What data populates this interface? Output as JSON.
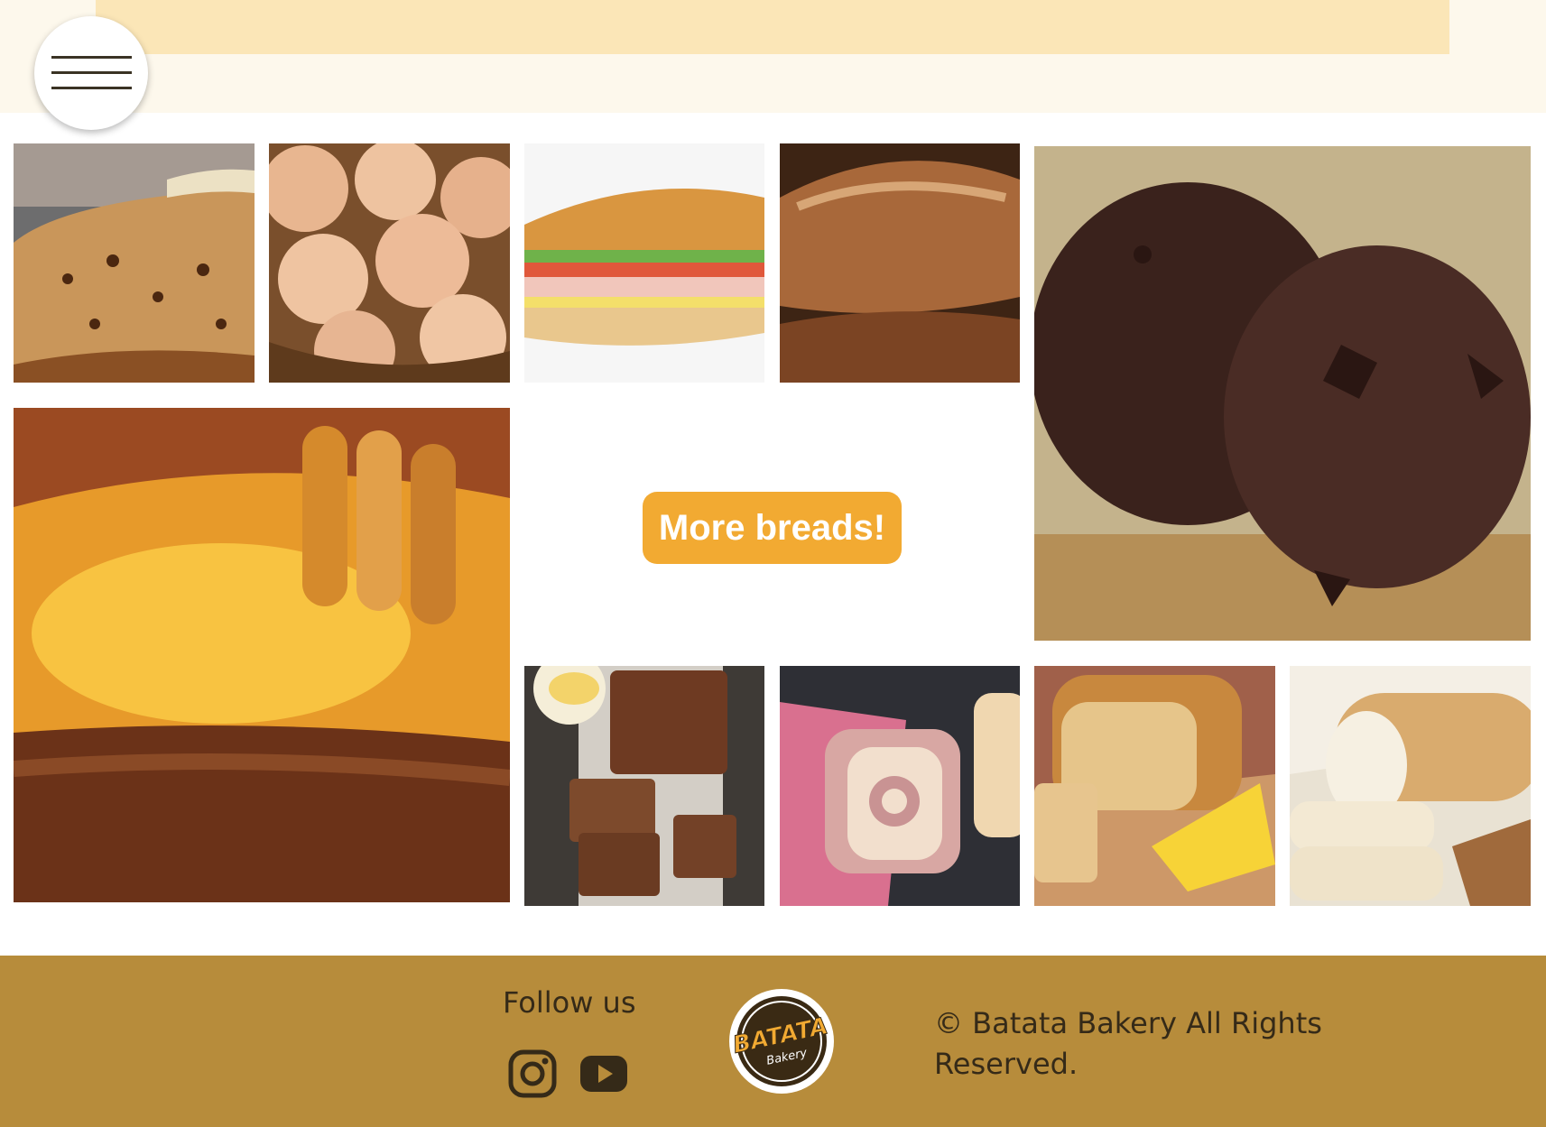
{
  "header": {
    "menu_icon": "hamburger-menu-icon",
    "colors": {
      "band": "#fbe6b7",
      "background": "#fdf8ec"
    }
  },
  "gallery": {
    "tiles": [
      {
        "name": "fruit-cake-slices-image",
        "icon": "fruit-cake-slices"
      },
      {
        "name": "cheese-bread-rolls-image",
        "icon": "cheese-bread-rolls"
      },
      {
        "name": "ham-sandwich-image",
        "icon": "submarine-sandwich"
      },
      {
        "name": "baguette-loaves-image",
        "icon": "baguette"
      },
      {
        "name": "chocolate-cookies-image",
        "icon": "chocolate-chip-cookies"
      },
      {
        "name": "honey-bread-image",
        "icon": "honey-dipper-on-bread"
      },
      {
        "name": "banana-bread-image",
        "icon": "banana-bread-slices"
      },
      {
        "name": "ham-swirl-bread-image",
        "icon": "ham-swirl-bread"
      },
      {
        "name": "pineapple-loaf-image",
        "icon": "pineapple-cake-loaf"
      },
      {
        "name": "white-bread-loaf-image",
        "icon": "white-bread-loaf"
      }
    ],
    "cta_label": "More breads!",
    "cta_color": "#f2aa32"
  },
  "footer": {
    "follow_label": "Follow us",
    "social_icons": [
      "instagram-icon",
      "youtube-icon"
    ],
    "logo_text": "BATATA",
    "logo_subtext": "Bakery",
    "copyright": "© Batata Bakery All Rights Reserved.",
    "background_color": "#b78c3b",
    "text_color": "#352a18"
  }
}
